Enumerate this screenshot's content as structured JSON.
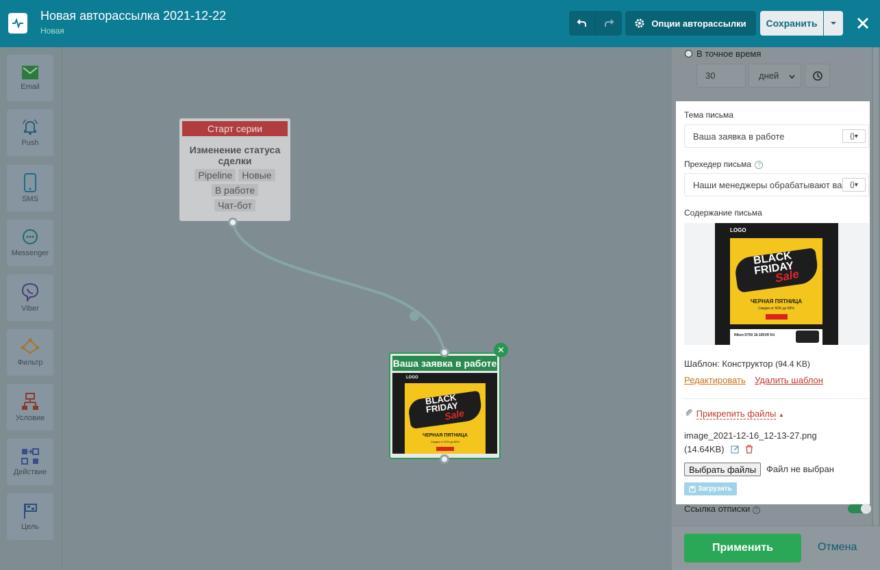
{
  "header": {
    "title": "Новая авторассылка 2021-12-22",
    "status": "Новая",
    "options_label": "Опции авторассылки",
    "save_label": "Сохранить"
  },
  "sidebar": {
    "items": [
      {
        "label": "Email",
        "icon": "email-icon"
      },
      {
        "label": "Push",
        "icon": "bell-icon"
      },
      {
        "label": "SMS",
        "icon": "phone-icon"
      },
      {
        "label": "Messenger",
        "icon": "chat-icon"
      },
      {
        "label": "Viber",
        "icon": "viber-icon"
      },
      {
        "label": "Фильтр",
        "icon": "filter-icon"
      },
      {
        "label": "Условие",
        "icon": "condition-icon"
      },
      {
        "label": "Действие",
        "icon": "action-icon"
      },
      {
        "label": "Цель",
        "icon": "goal-flag-icon"
      }
    ]
  },
  "canvas": {
    "start_node": {
      "header": "Старт серии",
      "title": "Изменение статуса сделки",
      "tags": [
        "Pipeline",
        "Новые",
        "В работе",
        "Чат-бот"
      ]
    },
    "email_node": {
      "title": "Ваша заявка в работе"
    },
    "thumb": {
      "logo": "LOGO",
      "black": "BLACK",
      "friday": "FRIDAY",
      "sale": "Sale",
      "headline": "ЧЕРНАЯ ПЯТНИЦА",
      "discount": "Скидки от 50% до 80%",
      "product": "Nikon D750 18-105VR Kit"
    }
  },
  "panel": {
    "timing": {
      "radio_label": "В точное время",
      "amount": "30",
      "unit": "дней"
    },
    "subject_label": "Тема письма",
    "subject_value": "Ваша заявка в работе",
    "preheader_label": "Прехедер письма",
    "preheader_value": "Наши менеджеры обрабатывают ва",
    "content_label": "Содержание письма",
    "template_label": "Шаблон: Конструктор",
    "template_size": "(94.4 KB)",
    "edit_link": "Редактировать",
    "delete_link": "Удалить шаблон",
    "attach_link": "Прикрепить файлы",
    "file_name": "image_2021-12-16_12-13-27.png",
    "file_size": "(14.64KB)",
    "choose_files": "Выбрать файлы",
    "no_file": "Файл не выбран",
    "upload": "Загрузить",
    "unsubscribe_label": "Ссылка отписки",
    "apply": "Применить",
    "cancel": "Отмена"
  }
}
